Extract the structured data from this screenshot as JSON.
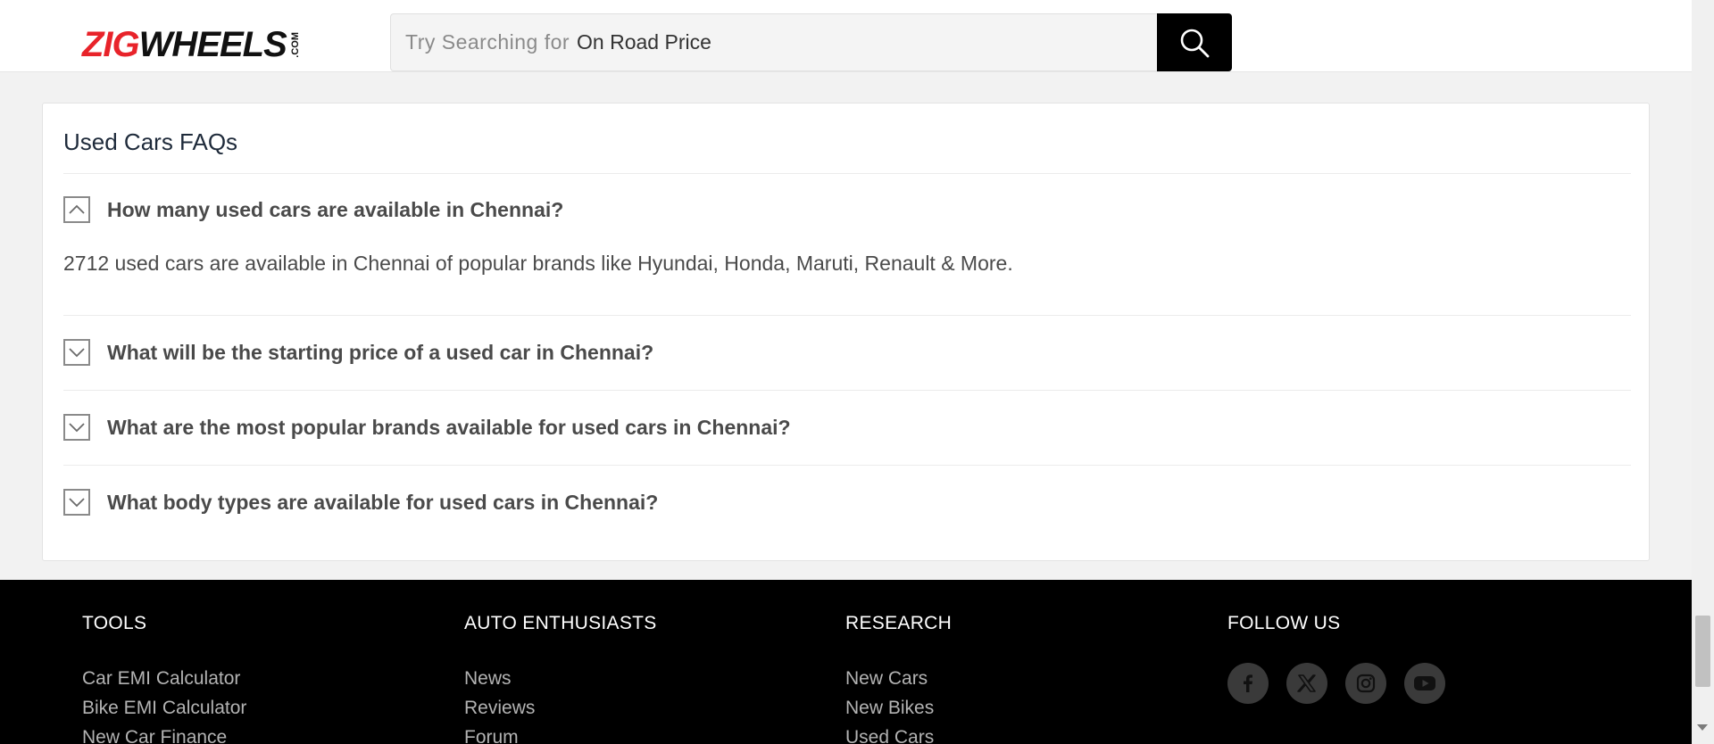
{
  "header": {
    "logo": {
      "zig": "ZIG",
      "wheels": "WHEELS",
      "dotcom": ".COM"
    },
    "search": {
      "placeholder": "Try Searching for",
      "rotating_term": "On Road Price",
      "button_icon": "search-icon"
    }
  },
  "faq": {
    "title": "Used Cars FAQs",
    "items": [
      {
        "question": "How many used cars are available in Chennai?",
        "expanded": true,
        "icon": "chevron-up-icon",
        "answer": "2712 used cars are available in Chennai of popular brands like Hyundai, Honda, Maruti, Renault & More."
      },
      {
        "question": "What will be the starting price of a used car in Chennai?",
        "expanded": false,
        "icon": "chevron-down-icon"
      },
      {
        "question": "What are the most popular brands available for used cars in Chennai?",
        "expanded": false,
        "icon": "chevron-down-icon"
      },
      {
        "question": "What body types are available for used cars in Chennai?",
        "expanded": false,
        "icon": "chevron-down-icon"
      }
    ]
  },
  "footer": {
    "tools": {
      "heading": "TOOLS",
      "links": [
        "Car EMI Calculator",
        "Bike EMI Calculator",
        "New Car Finance"
      ]
    },
    "auto_enthusiasts": {
      "heading": "AUTO ENTHUSIASTS",
      "links": [
        "News",
        "Reviews",
        "Forum"
      ]
    },
    "research": {
      "heading": "RESEARCH",
      "links": [
        "New Cars",
        "New Bikes",
        "Used Cars"
      ]
    },
    "follow_us": {
      "heading": "FOLLOW US",
      "icons": [
        "facebook-icon",
        "x-icon",
        "instagram-icon",
        "youtube-icon"
      ]
    }
  },
  "colors": {
    "brand_red": "#e8232a",
    "footer_bg": "#000000",
    "card_bg": "#ffffff",
    "page_bg": "#f2f2f2"
  }
}
